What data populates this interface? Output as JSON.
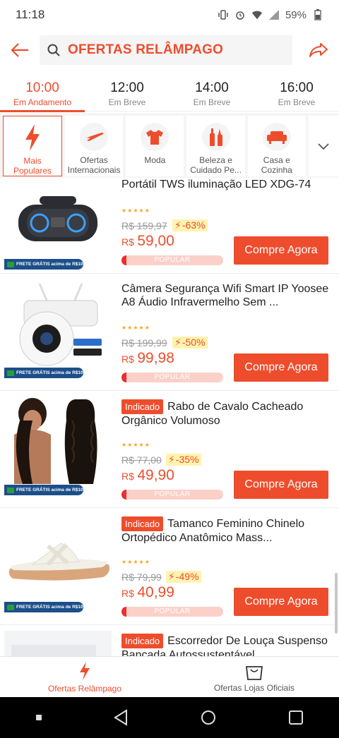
{
  "status_bar": {
    "time": "11:18",
    "battery": "59%"
  },
  "header": {
    "title": "OFERTAS RELÂMPAGO"
  },
  "time_slots": [
    {
      "time": "10:00",
      "status": "Em Andamento"
    },
    {
      "time": "12:00",
      "status": "Em Breve"
    },
    {
      "time": "14:00",
      "status": "Em Breve"
    },
    {
      "time": "16:00",
      "status": "Em Breve"
    }
  ],
  "categories": [
    {
      "label": "Mais Populares",
      "icon": "lightning-icon"
    },
    {
      "label": "Ofertas Internacionais",
      "icon": "airplane-icon"
    },
    {
      "label": "Moda",
      "icon": "tshirt-icon"
    },
    {
      "label": "Beleza e Cuidado Pe...",
      "icon": "beauty-icon"
    },
    {
      "label": "Casa e Cozinha",
      "icon": "sofa-icon"
    }
  ],
  "products": [
    {
      "title": "Portátil TWS iluminação LED XDG-74",
      "recommended": false,
      "old_price": "R$ 159,97",
      "discount": "-63%",
      "currency": "R$",
      "price": "59,00",
      "popular_label": "POPULAR",
      "popularity": 0.05,
      "buy_label": "Compre Agora",
      "free_shipping": "FRETE GRÁTIS acima de R$10"
    },
    {
      "title": "Câmera Segurança Wifi Smart IP Yoosee A8 Áudio Infravermelho Sem ...",
      "recommended": false,
      "old_price": "R$ 199,99",
      "discount": "-50%",
      "currency": "R$",
      "price": "99,98",
      "popular_label": "POPULAR",
      "popularity": 0.05,
      "buy_label": "Compre Agora",
      "free_shipping": "FRETE GRÁTIS acima de R$10"
    },
    {
      "title": "Rabo de Cavalo Cacheado Orgânico Volumoso",
      "recommended": true,
      "old_price": "R$ 77,00",
      "discount": "-35%",
      "currency": "R$",
      "price": "49,90",
      "popular_label": "POPULAR",
      "popularity": 0.05,
      "buy_label": "Compre Agora",
      "free_shipping": "FRETE GRÁTIS acima de R$10"
    },
    {
      "title": "Tamanco Feminino Chinelo Ortopédico Anatômico Mass...",
      "recommended": true,
      "old_price": "R$ 79,99",
      "discount": "-49%",
      "currency": "R$",
      "price": "40,99",
      "popular_label": "POPULAR",
      "popularity": 0.05,
      "buy_label": "Compre Agora",
      "free_shipping": "FRETE GRÁTIS acima de R$10"
    },
    {
      "title": "Escorredor De Louça Suspenso Bancada Autossustentável",
      "recommended": true
    }
  ],
  "badge_label": "Indicado",
  "bottom_nav": [
    {
      "label": "Ofertas Relâmpago",
      "icon": "lightning-icon"
    },
    {
      "label": "Ofertas Lojas Oficiais",
      "icon": "shopping-bag-icon"
    }
  ],
  "colors": {
    "accent": "#ee4d2d",
    "highlight": "#fff3b0"
  }
}
